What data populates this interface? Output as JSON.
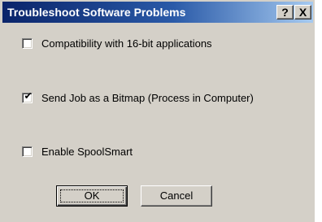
{
  "window": {
    "title": "Troubleshoot Software Problems",
    "help_button": "?",
    "close_button": "X"
  },
  "options": [
    {
      "label": "Compatibility with 16-bit applications",
      "checked": false
    },
    {
      "label": "Send Job as a Bitmap (Process in Computer)",
      "checked": true
    },
    {
      "label": "Enable SpoolSmart",
      "checked": false
    }
  ],
  "buttons": {
    "ok_label": "OK",
    "cancel_label": "Cancel"
  },
  "icons": {
    "check": "check-mark"
  },
  "colors": {
    "titlebar_start": "#0a246a",
    "titlebar_end": "#a6caf0",
    "dialog_bg": "#d4d0c8"
  }
}
